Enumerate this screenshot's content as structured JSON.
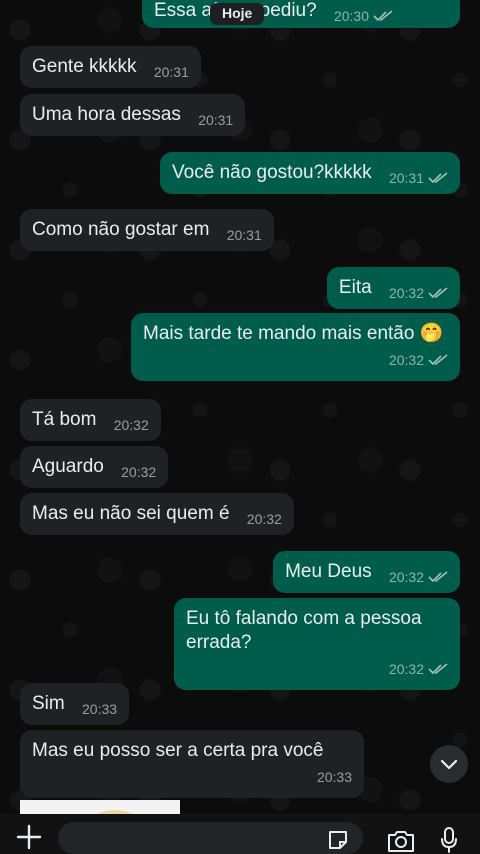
{
  "day_chip": "Hoje",
  "messages": [
    {
      "dir": "out",
      "text": "Essa aí que pediu?",
      "time": "20:30",
      "ticks": "read"
    },
    {
      "dir": "in",
      "text": "Gente kkkkk",
      "time": "20:31"
    },
    {
      "dir": "in",
      "text": "Uma hora dessas",
      "time": "20:31"
    },
    {
      "dir": "out",
      "text": "Você não gostou?kkkkk",
      "time": "20:31",
      "ticks": "read"
    },
    {
      "dir": "in",
      "text": "Como não gostar em",
      "time": "20:31"
    },
    {
      "dir": "out",
      "text": "Eita",
      "time": "20:32",
      "ticks": "read"
    },
    {
      "dir": "out",
      "text": "Mais tarde te mando mais então 🤭",
      "time": "20:32",
      "ticks": "read"
    },
    {
      "dir": "in",
      "text": "Tá bom",
      "time": "20:32"
    },
    {
      "dir": "in",
      "text": "Aguardo",
      "time": "20:32"
    },
    {
      "dir": "in",
      "text": "Mas eu não sei quem é",
      "time": "20:32"
    },
    {
      "dir": "out",
      "text": "Meu Deus",
      "time": "20:32",
      "ticks": "read"
    },
    {
      "dir": "out",
      "text": "Eu tô falando com a pessoa errada?",
      "time": "20:32",
      "ticks": "read"
    },
    {
      "dir": "in",
      "text": "Sim",
      "time": "20:33"
    },
    {
      "dir": "in",
      "text": "Mas eu posso ser a certa pra você",
      "time": "20:33"
    }
  ],
  "composer": {
    "placeholder": "",
    "icons": [
      "plus-icon",
      "sticker-icon",
      "camera-icon",
      "mic-icon"
    ]
  },
  "colors": {
    "incoming_bubble": "#1f2125",
    "outgoing_bubble": "#005c4b",
    "read_ticks": "#a8c2ba",
    "background": "#0c0c0c"
  }
}
